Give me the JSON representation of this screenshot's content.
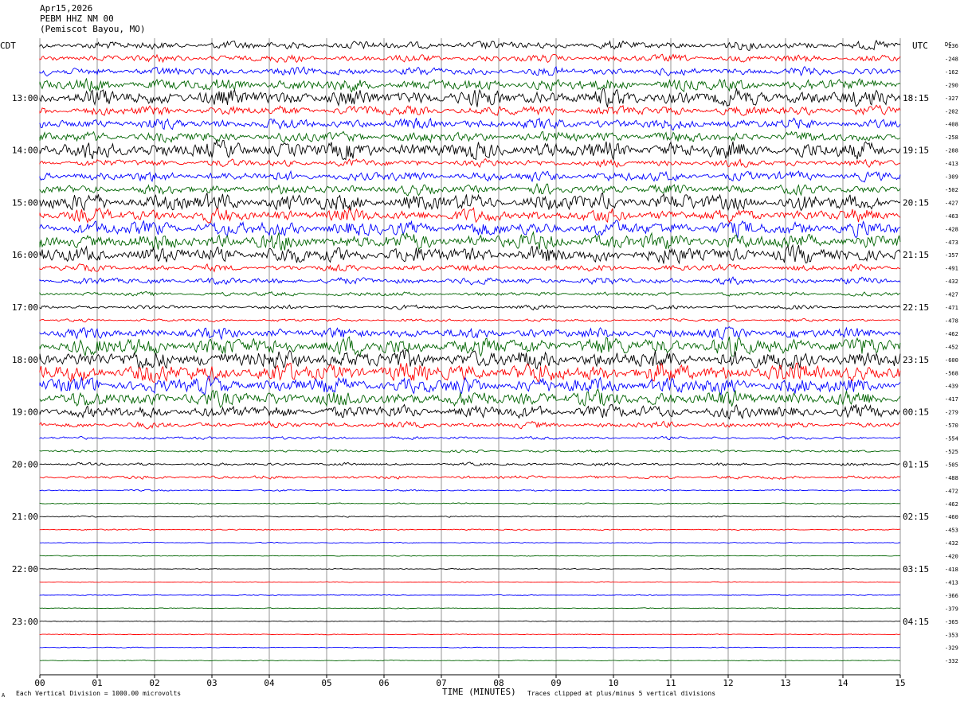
{
  "header": {
    "date": "Apr15,2026",
    "station": "PEBM HHZ NM 00",
    "location": "(Pemiscot Bayou, MO)"
  },
  "left_tz": "CDT",
  "right_tz": "UTC",
  "dc_label": "DC",
  "footer": {
    "scale_note": "Each Vertical Division = 1000.00 microvolts",
    "clip_note": "Traces clipped at plus/minus 5 vertical divisions",
    "corner_mark": "A"
  },
  "colors": {
    "trace_cycle": [
      "#000000",
      "#ff0000",
      "#0000ff",
      "#006400"
    ],
    "grid": "#000000"
  },
  "chart_data": {
    "type": "line",
    "xlabel": "TIME (MINUTES)",
    "x_ticks": [
      "00",
      "01",
      "02",
      "03",
      "04",
      "05",
      "06",
      "07",
      "08",
      "09",
      "10",
      "11",
      "12",
      "13",
      "14",
      "15"
    ],
    "xlim": [
      0,
      15
    ],
    "left_hour_labels": [
      "13:00",
      "14:00",
      "15:00",
      "16:00",
      "17:00",
      "18:00",
      "19:00",
      "20:00",
      "21:00",
      "22:00",
      "23:00"
    ],
    "right_hour_labels": [
      "18:15",
      "19:15",
      "20:15",
      "21:15",
      "22:15",
      "23:15",
      "00:15",
      "01:15",
      "02:15",
      "03:15",
      "04:15"
    ],
    "dc_offsets": [
      "236",
      "248",
      "162",
      "290",
      "327",
      "202",
      "408",
      "258",
      "288",
      "413",
      "309",
      "502",
      "427",
      "463",
      "428",
      "473",
      "357",
      "491",
      "432",
      "427",
      "471",
      "478",
      "462",
      "452",
      "600",
      "568",
      "439",
      "417",
      "279",
      "570",
      "554",
      "525",
      "505",
      "488",
      "472",
      "462",
      "460",
      "453",
      "432",
      "420",
      "418",
      "413",
      "366",
      "379",
      "365",
      "353",
      "329",
      "332"
    ],
    "trace_activity": [
      1.0,
      0.9,
      1.0,
      1.5,
      2.0,
      1.2,
      1.3,
      1.3,
      2.1,
      0.9,
      1.2,
      1.2,
      2.1,
      1.6,
      1.8,
      2.0,
      2.0,
      0.8,
      0.8,
      0.5,
      0.5,
      0.35,
      1.3,
      2.2,
      2.3,
      2.3,
      2.0,
      1.9,
      1.6,
      0.75,
      0.35,
      0.3,
      0.35,
      0.4,
      0.2,
      0.15,
      0.18,
      0.16,
      0.12,
      0.1,
      0.1,
      0.1,
      0.1,
      0.1,
      0.1,
      0.1,
      0.1,
      0.1
    ]
  }
}
